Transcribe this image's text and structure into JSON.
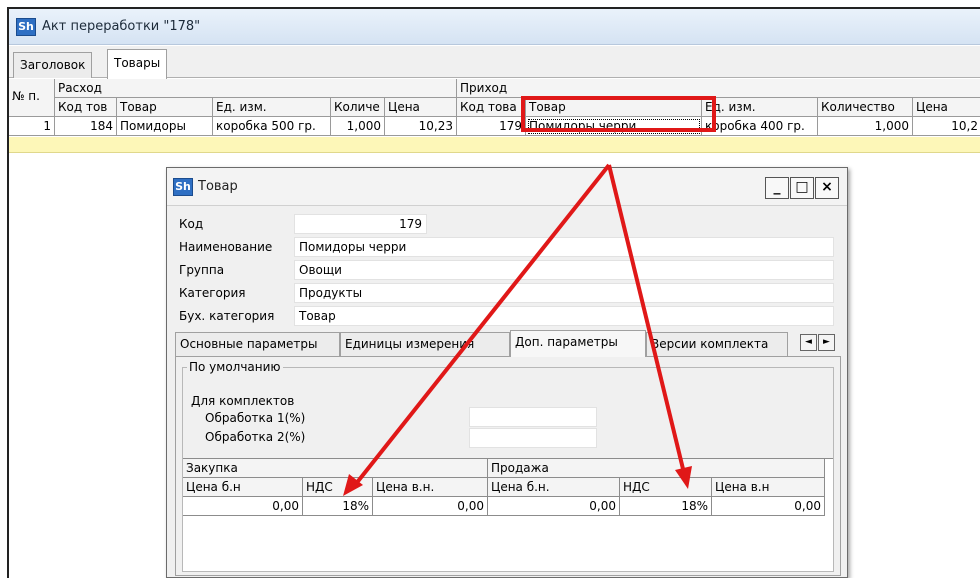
{
  "window": {
    "title": "Акт переработки \"178\"",
    "icon_label": "Sh"
  },
  "tabs": [
    {
      "label": "Заголовок"
    },
    {
      "label": "Товары"
    }
  ],
  "grid": {
    "row_number_header": "№ п.",
    "group_out": "Расход",
    "group_in": "Приход",
    "columns": [
      "Код тов",
      "Товар",
      "Ед. изм.",
      "Количе",
      "Цена",
      "Код това",
      "Товар",
      "Ед. изм.",
      "Количество",
      "Цена"
    ],
    "row": [
      "1",
      "184",
      "Помидоры",
      "коробка 500 гр.",
      "1,000",
      "10,23",
      "179",
      "Помидоры черри",
      "коробка 400 гр.",
      "1,000",
      "10,2"
    ]
  },
  "dialog": {
    "title": "Товар",
    "icon_label": "Sh",
    "buttons": {
      "minimize": "_",
      "maximize": "□",
      "close": "×"
    },
    "fields": [
      {
        "label": "Код",
        "value": "179"
      },
      {
        "label": "Наименование",
        "value": "Помидоры черри"
      },
      {
        "label": "Группа",
        "value": "Овощи"
      },
      {
        "label": "Категория",
        "value": "Продукты"
      },
      {
        "label": "Бух. категория",
        "value": "Товар"
      }
    ],
    "tabs": [
      {
        "label": "Основные параметры"
      },
      {
        "label": "Единицы измерения"
      },
      {
        "label": "Доп. параметры"
      },
      {
        "label": "Версии комплекта"
      }
    ],
    "scroll": {
      "left": "◄",
      "right": "►"
    },
    "group_title": "По умолчанию",
    "kits_label": "Для комплектов",
    "processing": [
      {
        "label": "Обработка 1(%)",
        "value": ""
      },
      {
        "label": "Обработка 2(%)",
        "value": ""
      }
    ],
    "price_grid": {
      "purchase": "Закупка",
      "sale": "Продажа",
      "columns": [
        "Цена б.н",
        "НДС",
        "Цена в.н.",
        "Цена б.н.",
        "НДС",
        "Цена в.н"
      ],
      "row": [
        "0,00",
        "18%",
        "0,00",
        "0,00",
        "18%",
        "0,00"
      ]
    }
  },
  "colors": {
    "annotation": "#e01818",
    "highlight_row": "#fdf7b8",
    "title_bar": "#d5e3f3"
  }
}
